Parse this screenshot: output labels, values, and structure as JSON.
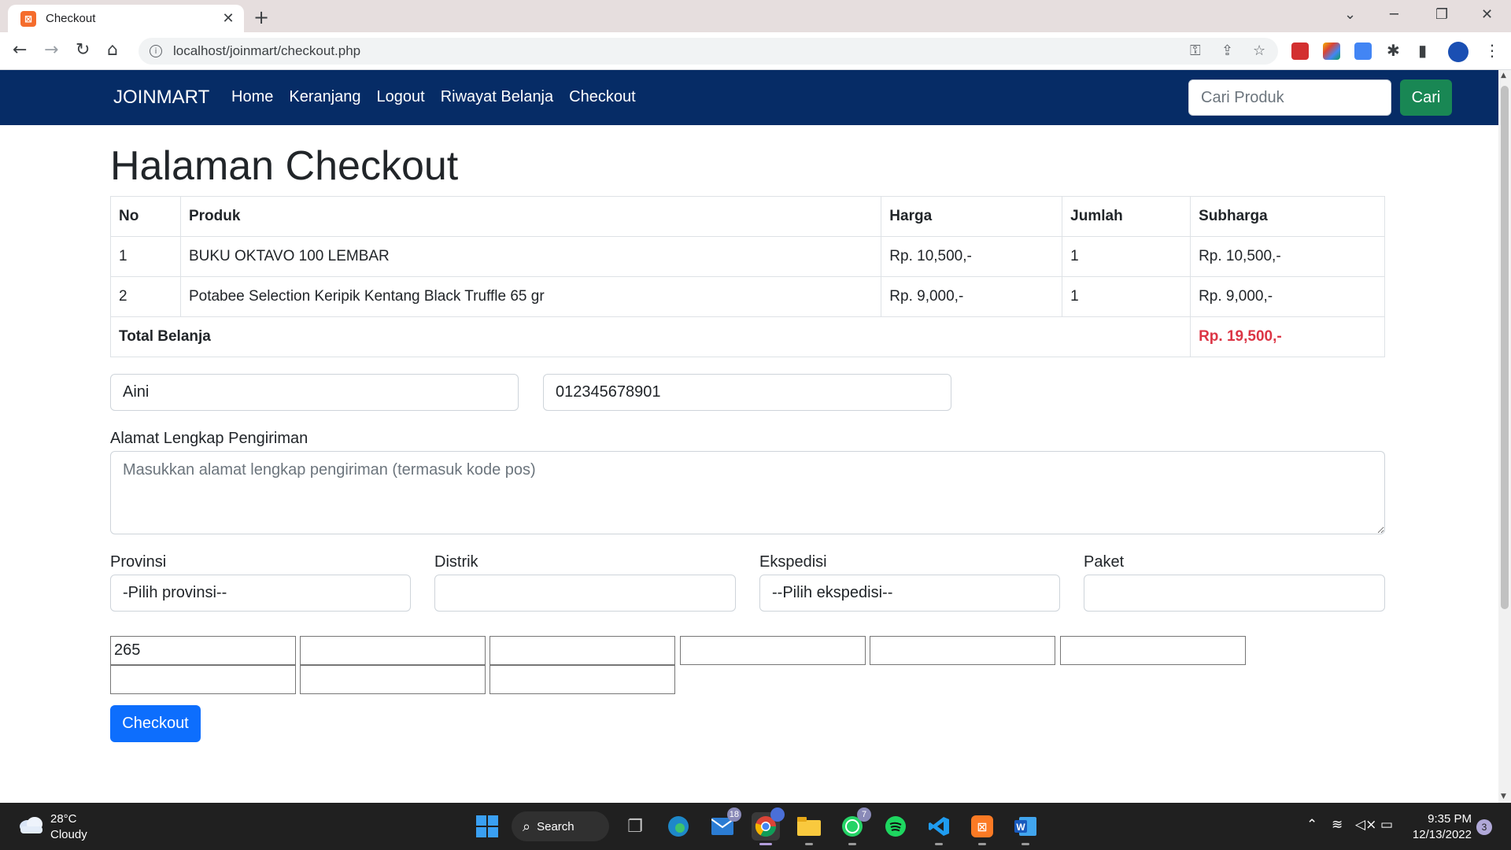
{
  "browser": {
    "tab_title": "Checkout",
    "tab_favicon": "⊠",
    "close_glyph": "✕",
    "newtab_glyph": "+",
    "url": "localhost/joinmart/checkout.php"
  },
  "navbar": {
    "brand": "JOINMART",
    "links": [
      "Home",
      "Keranjang",
      "Logout",
      "Riwayat Belanja",
      "Checkout"
    ],
    "search_placeholder": "Cari Produk",
    "search_button": "Cari"
  },
  "page": {
    "title": "Halaman Checkout"
  },
  "cart": {
    "headers": [
      "No",
      "Produk",
      "Harga",
      "Jumlah",
      "Subharga"
    ],
    "rows": [
      [
        "1",
        "BUKU OKTAVO 100 LEMBAR",
        "Rp. 10,500,-",
        "1",
        "Rp. 10,500,-"
      ],
      [
        "2",
        "Potabee Selection Keripik Kentang Black Truffle 65 gr",
        "Rp. 9,000,-",
        "1",
        "Rp. 9,000,-"
      ]
    ],
    "total_label": "Total Belanja",
    "total_value": "Rp. 19,500,-"
  },
  "form": {
    "name_value": "Aini",
    "phone_value": "012345678901",
    "address_label": "Alamat Lengkap Pengiriman",
    "address_placeholder": "Masukkan alamat lengkap pengiriman (termasuk kode pos)",
    "provinsi_label": "Provinsi",
    "provinsi_value": "-Pilih provinsi--",
    "distrik_label": "Distrik",
    "distrik_value": "",
    "ekspedisi_label": "Ekspedisi",
    "ekspedisi_value": "--Pilih ekspedisi--",
    "paket_label": "Paket",
    "paket_value": "",
    "hidden_fields": [
      "265",
      "",
      "",
      "",
      "",
      "",
      "",
      "",
      ""
    ],
    "checkout_button": "Checkout"
  },
  "taskbar": {
    "weather_temp": "28°C",
    "weather_desc": "Cloudy",
    "search_label": "Search",
    "mail_badge": "18",
    "whatsapp_badge": "7",
    "time": "9:35 PM",
    "date": "12/13/2022",
    "notification_count": "3"
  },
  "colors": {
    "navbar_bg": "#062c66",
    "search_button": "#198754",
    "checkout_button": "#0d6efd",
    "total_value": "#dc3545"
  },
  "icons": [
    "favicon-icon",
    "back-icon",
    "forward-icon",
    "reload-icon",
    "home-icon",
    "info-icon",
    "key-icon",
    "share-icon",
    "star-icon",
    "extensions-icon",
    "sidepanel-icon",
    "menu-icon",
    "windows-start-icon",
    "search-icon",
    "edge-icon",
    "mail-icon",
    "chrome-icon",
    "explorer-icon",
    "whatsapp-icon",
    "spotify-icon",
    "vscode-icon",
    "xampp-icon",
    "word-icon",
    "wifi-icon",
    "volume-icon",
    "battery-icon"
  ]
}
